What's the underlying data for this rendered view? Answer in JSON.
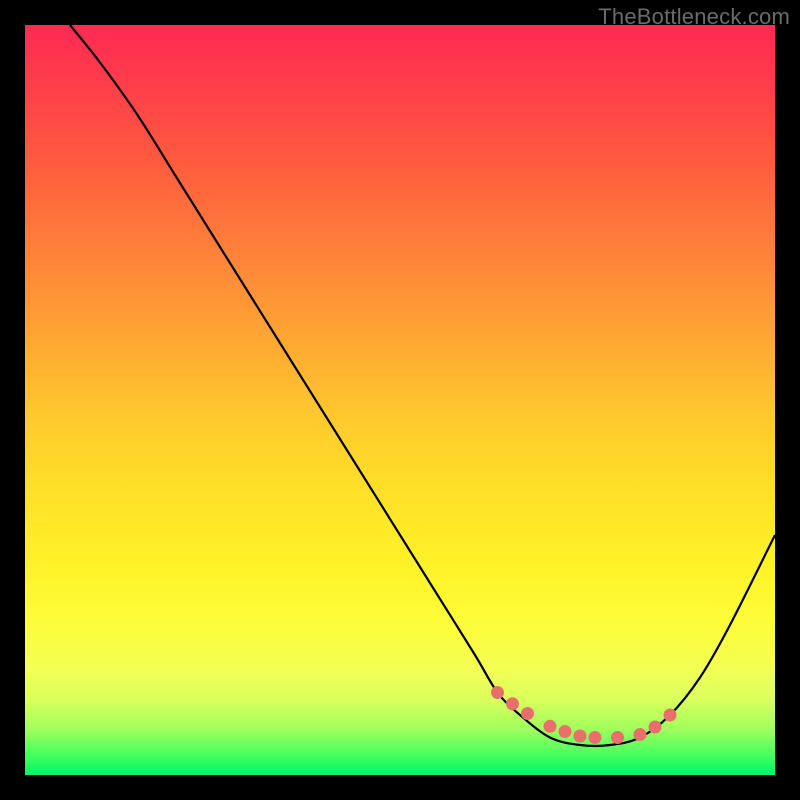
{
  "watermark": "TheBottleneck.com",
  "chart_data": {
    "type": "line",
    "title": "",
    "xlabel": "",
    "ylabel": "",
    "xlim": [
      0,
      100
    ],
    "ylim": [
      0,
      100
    ],
    "grid": false,
    "legend": false,
    "series": [
      {
        "name": "bottleneck-curve",
        "x": [
          6,
          10,
          15,
          20,
          25,
          30,
          35,
          40,
          45,
          50,
          55,
          60,
          63,
          66,
          70,
          74,
          78,
          82,
          86,
          90,
          94,
          100
        ],
        "y": [
          100,
          95,
          88,
          80,
          72,
          64,
          56,
          48,
          40,
          32,
          24,
          16,
          11,
          8,
          5,
          4,
          4,
          5,
          8,
          13,
          20,
          32
        ]
      }
    ],
    "markers": {
      "name": "highlight-dots",
      "color": "#e96f6d",
      "x": [
        63,
        65,
        67,
        70,
        72,
        74,
        76,
        79,
        82,
        84,
        86
      ],
      "y": [
        11,
        9.5,
        8.2,
        6.5,
        5.8,
        5.2,
        5.0,
        5.0,
        5.4,
        6.4,
        8.0
      ]
    }
  }
}
